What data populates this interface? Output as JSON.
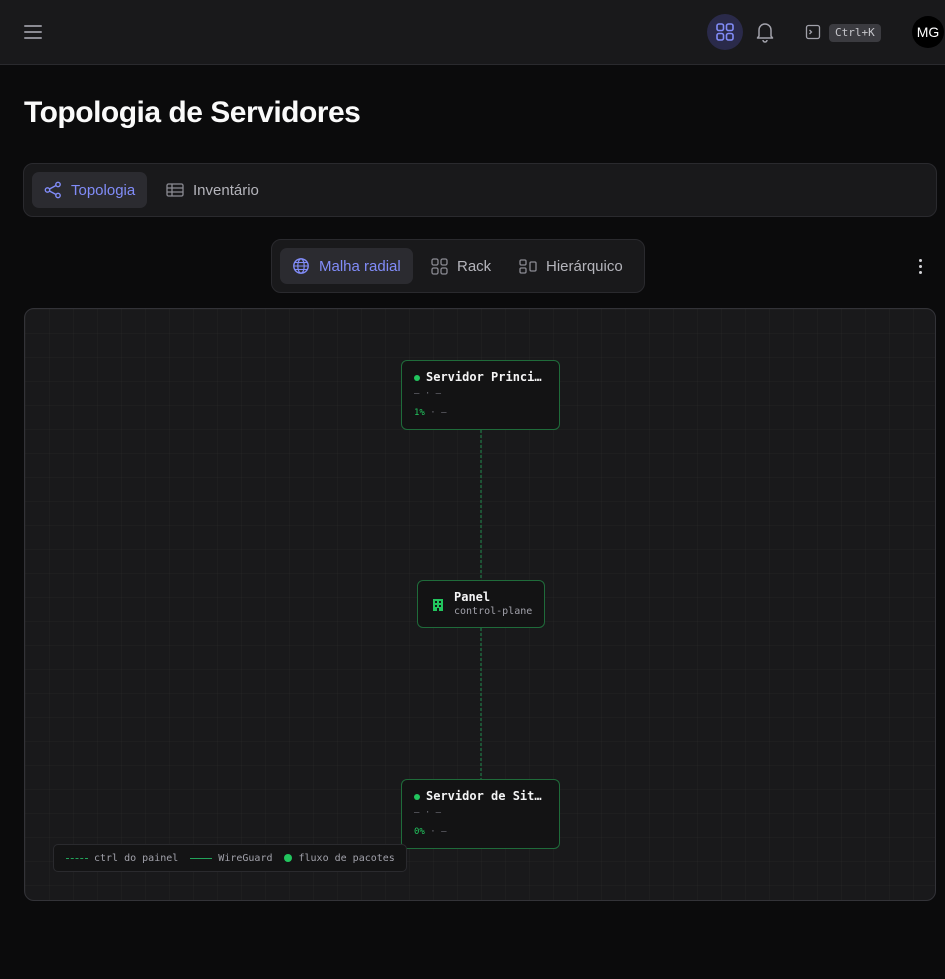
{
  "topbar": {
    "menu_icon": "hamburger-menu-icon",
    "apps_icon": "grid-apps-icon",
    "notifications_icon": "bell-icon",
    "command_icon": "terminal-icon",
    "shortcut": "Ctrl+K",
    "avatar_initials": "MG"
  },
  "page": {
    "title": "Topologia de Servidores"
  },
  "tabs": [
    {
      "label": "Topologia",
      "icon": "share-nodes-icon",
      "active": true
    },
    {
      "label": "Inventário",
      "icon": "table-icon",
      "active": false
    }
  ],
  "view_modes": [
    {
      "label": "Malha radial",
      "icon": "globe-icon",
      "active": true
    },
    {
      "label": "Rack",
      "icon": "grid-icon",
      "active": false
    },
    {
      "label": "Hierárquico",
      "icon": "hierarchy-icon",
      "active": false
    }
  ],
  "topology": {
    "nodes": [
      {
        "name": "Servidor Princi…",
        "status": "online",
        "meta": "— · —",
        "cpu": "1%",
        "sep": " · ",
        "extra": "—"
      },
      {
        "name": "Servidor de Sit…",
        "status": "online",
        "meta": "— · —",
        "cpu": "0%",
        "sep": " · ",
        "extra": "—"
      }
    ],
    "panel": {
      "name": "Panel",
      "role": "control-plane",
      "icon": "building-icon"
    }
  },
  "legend": {
    "ctrl": "ctrl do painel",
    "wireguard": "WireGuard",
    "packets": "fluxo de pacotes"
  },
  "colors": {
    "accent": "#818cf8",
    "online": "#22c55e",
    "edge": "#22a35a"
  }
}
